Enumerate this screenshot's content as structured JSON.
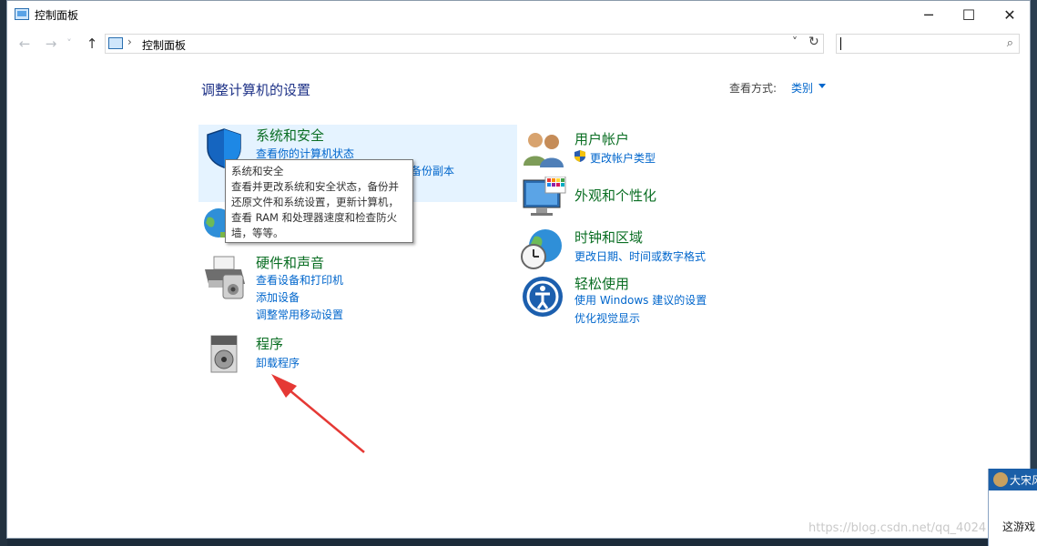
{
  "window": {
    "title": "控制面板",
    "minimize_glyph": "─",
    "maximize_glyph": "☐",
    "close_glyph": "✕"
  },
  "address_bar": {
    "back_glyph": "←",
    "forward_glyph": "→",
    "recent_glyph": "˅",
    "up_glyph": "↑",
    "separator": "›",
    "path": "控制面板",
    "dropdown_glyph": "˅",
    "refresh_glyph": "↻",
    "search_value": "",
    "search_glyph": "⌕"
  },
  "main": {
    "title": "调整计算机的设置",
    "view_by_label": "查看方式:",
    "view_by_value": "类别"
  },
  "categories": {
    "system_security": {
      "title": "系统和安全",
      "links": [
        "查看你的计算机状态",
        "备份副本"
      ]
    },
    "hardware_sound": {
      "title": "硬件和声音",
      "links": [
        "查看设备和打印机",
        "添加设备",
        "调整常用移动设置"
      ]
    },
    "programs": {
      "title": "程序",
      "links": [
        "卸载程序"
      ]
    },
    "user_accounts": {
      "title": "用户帐户",
      "links": [
        "更改帐户类型"
      ]
    },
    "appearance": {
      "title": "外观和个性化",
      "links": []
    },
    "clock_region": {
      "title": "时钟和区域",
      "links": [
        "更改日期、时间或数字格式"
      ]
    },
    "ease_of_access": {
      "title": "轻松使用",
      "links": [
        "使用 Windows 建议的设置",
        "优化视觉显示"
      ]
    }
  },
  "tooltip": {
    "lines": [
      "系统和安全",
      "查看并更改系统和安全状态，备份并",
      "还原文件和系统设置，更新计算机，",
      "查看 RAM 和处理器速度和检查防火",
      "墙，等等。"
    ]
  },
  "watermark": "https://blog.csdn.net/qq_4024",
  "popup": {
    "title": "大宋风",
    "body": "这游戏"
  },
  "icons": {
    "shield": "shield-icon",
    "users": "users-icon",
    "monitor": "monitor-icon",
    "globe": "globe-icon",
    "printer": "printer-icon",
    "clock_globe": "clock-globe-icon",
    "accessibility": "accessibility-icon",
    "programs": "programs-icon",
    "uac": "uac-shield-icon"
  },
  "colors": {
    "category_title": "#0a6e23",
    "link": "#0066cc",
    "heading": "#1e3287",
    "highlight": "#e5f3ff",
    "arrow": "#e53935"
  }
}
